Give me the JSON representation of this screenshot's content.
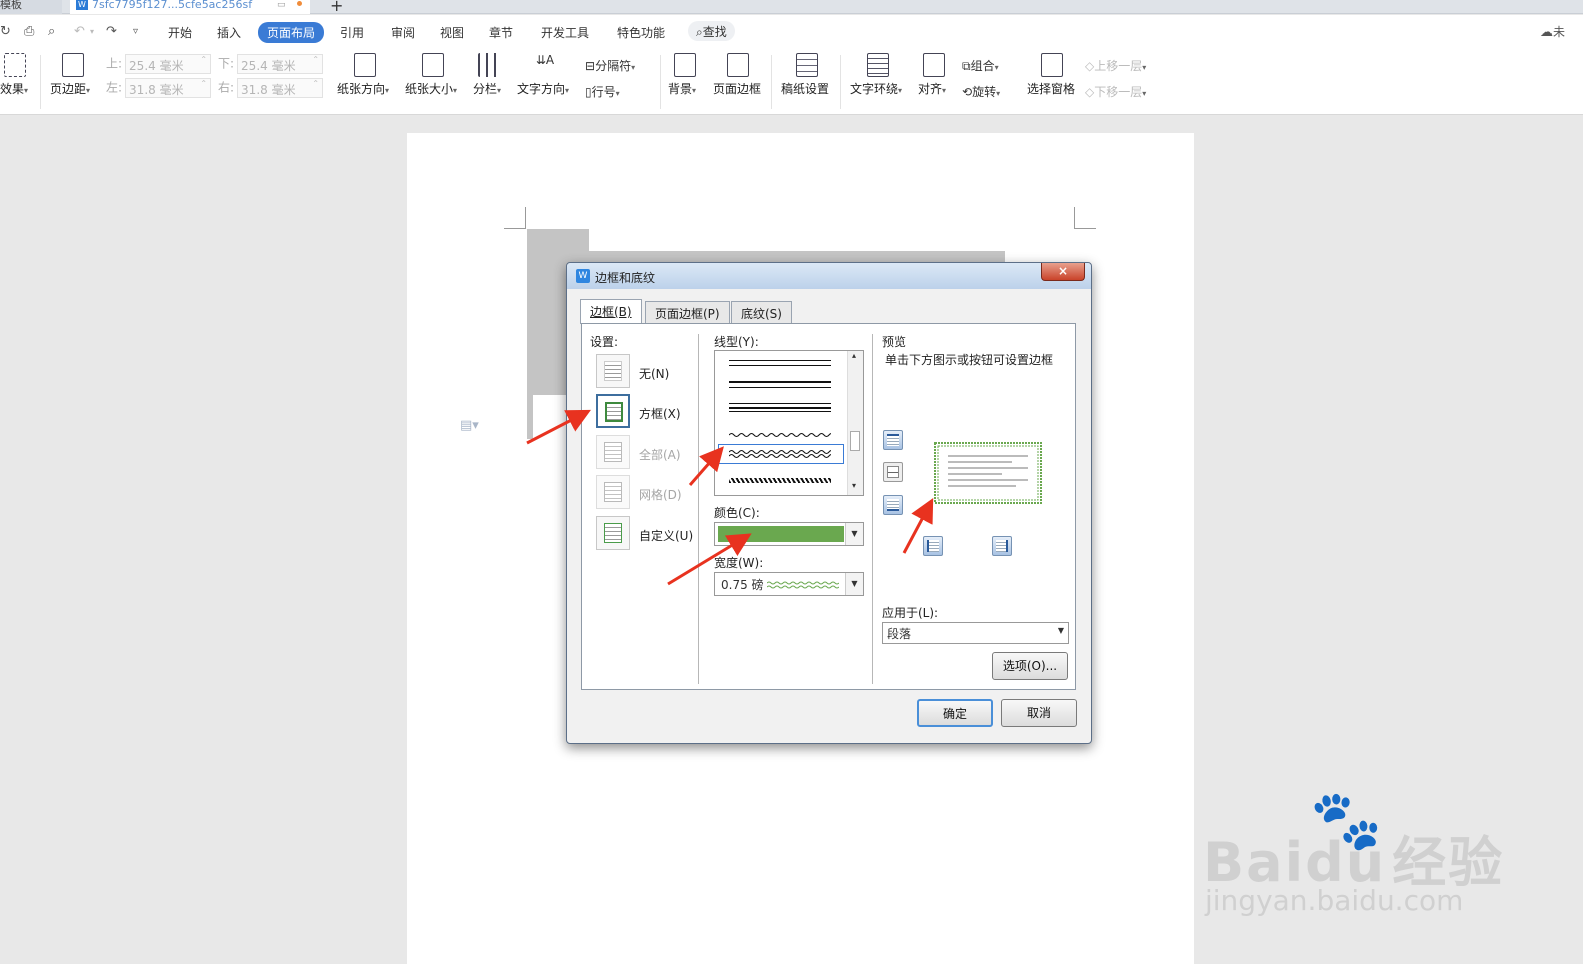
{
  "tabs": {
    "template_tab": "模板",
    "doc_tab": "7sfc7795f127...5cfe5ac256sf",
    "new_tab": "+"
  },
  "menu": {
    "items": [
      "开始",
      "插入",
      "页面布局",
      "引用",
      "审阅",
      "视图",
      "章节",
      "开发工具",
      "特色功能"
    ],
    "active": "页面布局",
    "search": "查找",
    "cloud_text": "未"
  },
  "ribbon": {
    "effects": "效果",
    "margins": "页边距",
    "top_label": "上:",
    "top_value": "25.4 毫米",
    "bottom_label": "下:",
    "bottom_value": "25.4 毫米",
    "left_label": "左:",
    "left_value": "31.8 毫米",
    "right_label": "右:",
    "right_value": "31.8 毫米",
    "orientation": "纸张方向",
    "size": "纸张大小",
    "columns": "分栏",
    "text_direction": "文字方向",
    "separator": "分隔符",
    "line_number": "行号",
    "background": "背景",
    "page_border": "页面边框",
    "manuscript": "稿纸设置",
    "wrap_text": "文字环绕",
    "align": "对齐",
    "group": "组合",
    "rotate": "旋转",
    "selection_pane": "选择窗格",
    "bring_forward": "上移一层",
    "send_backward": "下移一层"
  },
  "dialog": {
    "title": "边框和底纹",
    "close": "×",
    "tabs": [
      "边框(B)",
      "页面边框(P)",
      "底纹(S)"
    ],
    "setting_label": "设置:",
    "settings": [
      {
        "label": "无(N)",
        "enabled": true
      },
      {
        "label": "方框(X)",
        "enabled": true,
        "selected": true
      },
      {
        "label": "全部(A)",
        "enabled": false
      },
      {
        "label": "网格(D)",
        "enabled": false
      },
      {
        "label": "自定义(U)",
        "enabled": true
      }
    ],
    "linestyle_label": "线型(Y):",
    "color_label": "颜色(C):",
    "color_value": "#6aa84f",
    "width_label": "宽度(W):",
    "width_value": "0.75 磅",
    "preview_label": "预览",
    "preview_hint": "单击下方图示或按钮可设置边框",
    "apply_label": "应用于(L):",
    "apply_value": "段落",
    "options_button": "选项(O)...",
    "ok_button": "确定",
    "cancel_button": "取消"
  },
  "watermark": {
    "brand": "Bai",
    "brand_du": "du",
    "brand_cn": "经验",
    "url": "jingyan.baidu.com"
  },
  "colors": {
    "accent": "#3a7bd5",
    "border_green": "#6aa84f",
    "arrow_red": "#e8321f"
  }
}
